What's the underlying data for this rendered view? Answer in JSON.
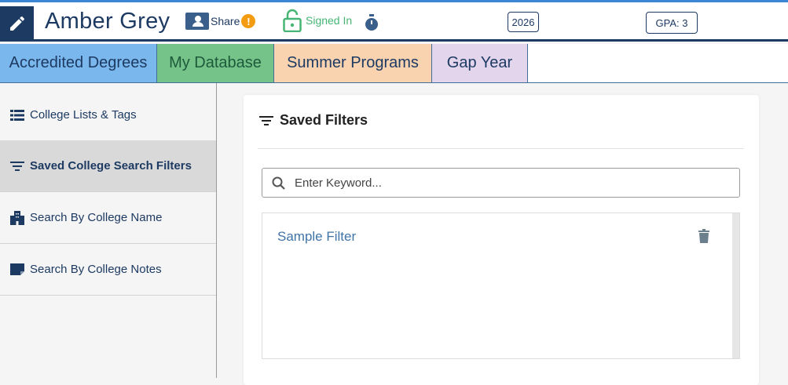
{
  "header": {
    "student_name": "Amber Grey",
    "share_label": "Share",
    "share_warning": "!",
    "signed_in_label": "Signed In",
    "year": "2026",
    "gpa": "GPA: 3"
  },
  "tabs": [
    {
      "label": "Accredited Degrees",
      "color": "#7ab7ec"
    },
    {
      "label": "My Database",
      "color": "#76c38a"
    },
    {
      "label": "Summer Programs",
      "color": "#f9d2b0"
    },
    {
      "label": "Gap Year",
      "color": "#e3d5ec"
    }
  ],
  "sidebar": {
    "items": [
      {
        "label": "College Lists & Tags",
        "icon": "list-icon"
      },
      {
        "label": "Saved College Search Filters",
        "icon": "filter-icon",
        "active": true
      },
      {
        "label": "Search By College Name",
        "icon": "building-icon"
      },
      {
        "label": "Search By College Notes",
        "icon": "note-icon"
      }
    ]
  },
  "panel": {
    "title": "Saved Filters",
    "search_placeholder": "Enter Keyword...",
    "filters": [
      {
        "name": "Sample Filter"
      }
    ]
  },
  "colors": {
    "navy": "#1d3a62",
    "accent_blue": "#3d86d6",
    "warning": "#f39c12",
    "signed_in_green": "#47b574",
    "link": "#3f74a8"
  }
}
